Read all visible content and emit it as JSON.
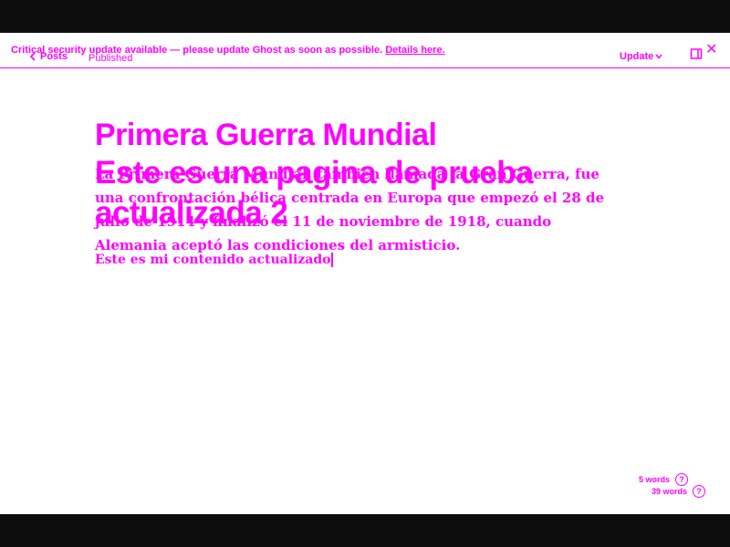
{
  "banner": {
    "message": "Critical security update available — please update Ghost as soon as possible.",
    "link_label": "Details here."
  },
  "header": {
    "back_label": "Posts",
    "status": "Published",
    "update_label": "Update"
  },
  "post": {
    "title": "Primera Guerra Mundial",
    "overlay_title": "Este es una pagina de prueba actualizada 2",
    "body": "La Primera Guerra Mundial, también llamada la Gran Guerra, fue una confrontación bélica centrada en Europa que empezó el 28 de julio de 1914 y finalizó el 11 de noviembre de 1918, cuando Alemania aceptó las condiciones del armisticio.",
    "editing_line": "Este es mi contenido actualizado"
  },
  "word_counts": {
    "primary": "5 words",
    "secondary": "39 words"
  },
  "icons": {
    "back": "chevron-left-icon",
    "dropdown": "chevron-down-icon",
    "sidebar": "sidebar-toggle-icon",
    "close": "close-icon",
    "help": "help-icon"
  },
  "colors": {
    "accent": "#ff00ff",
    "background": "#ffffff",
    "frame": "#0d0d0d"
  }
}
